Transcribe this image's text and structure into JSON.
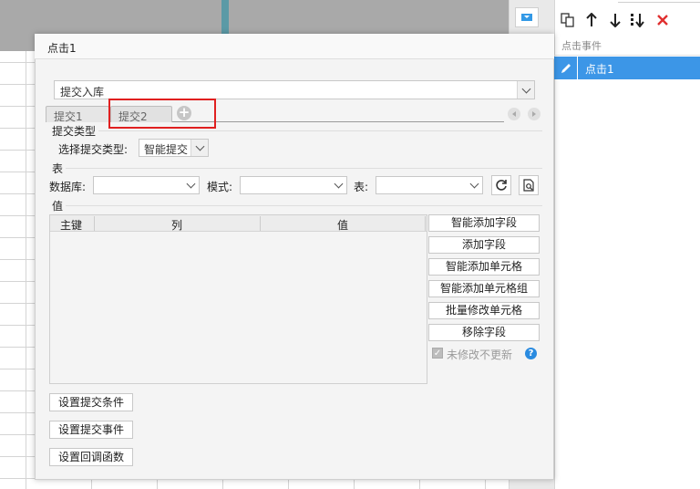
{
  "right_panel": {
    "section_title": "点击事件",
    "events": [
      {
        "label": "点击1"
      }
    ]
  },
  "dialog": {
    "title": "点击1",
    "action_select": {
      "value": "提交入库"
    },
    "tabs": [
      {
        "label": "提交1"
      },
      {
        "label": "提交2"
      }
    ],
    "submit_type": {
      "group_label": "提交类型",
      "field_label": "选择提交类型:",
      "value": "智能提交"
    },
    "table_group": {
      "group_label": "表",
      "database_label": "数据库:",
      "mode_label": "模式:",
      "table_label": "表:"
    },
    "values_group": {
      "group_label": "值",
      "columns": [
        "主键",
        "列",
        "值"
      ],
      "buttons": [
        "智能添加字段",
        "添加字段",
        "智能添加单元格",
        "智能添加单元格组",
        "批量修改单元格",
        "移除字段"
      ],
      "checkbox_label": "未修改不更新",
      "checkbox_checked": true
    },
    "bottom_buttons": [
      "设置提交条件",
      "设置提交事件",
      "设置回调函数"
    ]
  },
  "colors": {
    "accent": "#3c96e7",
    "highlight_box": "#e02020",
    "delete_icon": "#e03030"
  }
}
